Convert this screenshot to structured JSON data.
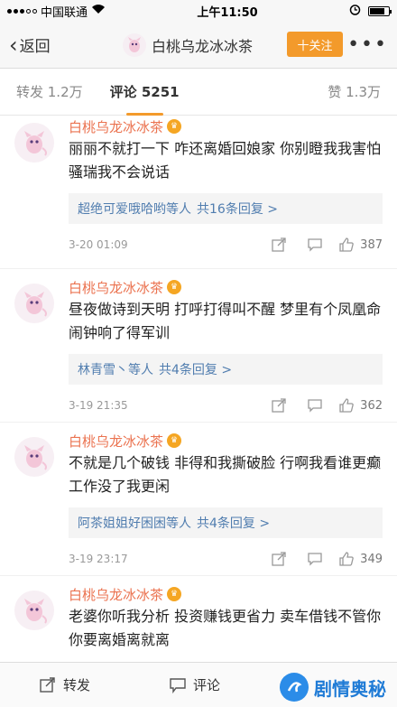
{
  "status": {
    "carrier": "中国联通",
    "time": "上午11:50"
  },
  "nav": {
    "back_label": "返回",
    "title": "白桃乌龙冰冰茶",
    "follow_label": "十关注"
  },
  "tabs": {
    "repost": "转发 1.2万",
    "comment": "评论 5251",
    "like": "赞 1.3万"
  },
  "comments": [
    {
      "user": "白桃乌龙冰冰茶",
      "text": "丽丽不就打一下 咋还离婚回娘家 你别瞪我我害怕 骚瑞我不会说话",
      "reply_names": "超绝可爱哦哈哟等人",
      "reply_count": "共16条回复 >",
      "time": "3-20 01:09",
      "likes": "387"
    },
    {
      "user": "白桃乌龙冰冰茶",
      "text": "昼夜做诗到天明 打呼打得叫不醒 梦里有个凤凰命 闹钟响了得军训",
      "reply_names": "林青雪丶等人",
      "reply_count": "共4条回复 >",
      "time": "3-19 21:35",
      "likes": "362"
    },
    {
      "user": "白桃乌龙冰冰茶",
      "text": "不就是几个破钱 非得和我撕破脸 行啊我看谁更癫 工作没了我更闲",
      "reply_names": "阿茶姐姐好困困等人",
      "reply_count": "共4条回复 >",
      "time": "3-19 23:17",
      "likes": "349"
    },
    {
      "user": "白桃乌龙冰冰茶",
      "text": "老婆你听我分析 投资赚钱更省力 卖车借钱不管你 你要离婚离就离"
    }
  ],
  "bottom": {
    "repost": "转发",
    "comment": "评论"
  },
  "watermark": "剧情奥秘",
  "colors": {
    "accent": "#f39a2b",
    "username": "#eb7350",
    "link": "#507daf"
  }
}
